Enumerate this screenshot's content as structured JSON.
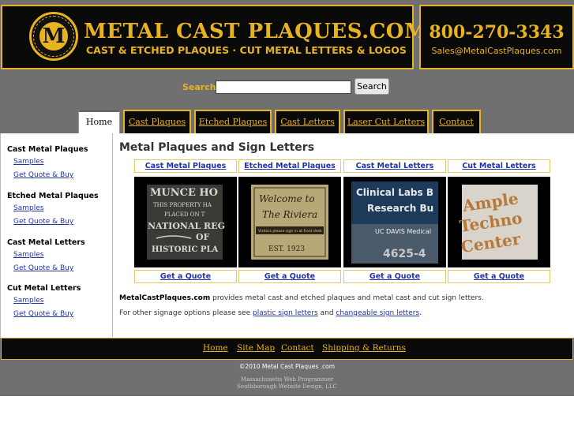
{
  "header": {
    "title": "METAL CAST PLAQUES.COM",
    "tagline": "CAST & ETCHED PLAQUES · CUT METAL LETTERS & LOGOS",
    "seal_letter": "M",
    "seal_ring_text": "CAST & ETCHED PLAQUES · METAL LETTERS & LOGOS",
    "phone": "800-270-3343",
    "email": "Sales@MetalCastPlaques.com"
  },
  "search": {
    "label": "Search:",
    "value": "",
    "placeholder": "",
    "button": "Search"
  },
  "tabs": [
    "Home",
    "Cast Plaques",
    "Etched Plaques",
    "Cast Letters",
    "Laser Cut Letters",
    "Contact"
  ],
  "active_tab": "Home",
  "sidebar": [
    {
      "heading": "Cast Metal Plaques",
      "links": [
        "Samples",
        "Get Quote & Buy"
      ]
    },
    {
      "heading": "Etched Metal Plaques",
      "links": [
        "Samples",
        "Get Quote & Buy"
      ]
    },
    {
      "heading": "Cast Metal Letters",
      "links": [
        "Samples",
        "Get Quote & Buy"
      ]
    },
    {
      "heading": "Cut Metal Letters",
      "links": [
        "Samples",
        "Get Quote & Buy"
      ]
    }
  ],
  "main": {
    "title": "Metal Plaques and Sign Letters",
    "products": [
      {
        "label": "Cast Metal Plaques",
        "quote": "Get a Quote",
        "photo_lines": [
          "MUNCE HO",
          "THIS PROPERTY HA",
          "PLACED ON T",
          "NATIONAL REG",
          "OF",
          "HISTORIC PLA"
        ]
      },
      {
        "label": "Etched Metal Plaques",
        "quote": "Get a Quote",
        "photo_lines": [
          "Welcome to",
          "The Riviera",
          "Visitors please sign in at front desk",
          "EST. 1923"
        ]
      },
      {
        "label": "Cast Metal Letters",
        "quote": "Get a Quote",
        "photo_lines": [
          "Clinical Labs B",
          "Research Bu",
          "UC DAVIS Medical",
          "4625-4"
        ]
      },
      {
        "label": "Cut Metal Letters",
        "quote": "Get a Quote",
        "photo_lines": [
          "Ample",
          "Techno",
          "Center"
        ]
      }
    ],
    "desc1_bold": "MetalCastPlaques.com",
    "desc1_rest": " provides metal cast and etched plaques and metal cast and cut sign letters.",
    "desc2_pre": "For other signage options please see ",
    "desc2_link1": "plastic sign letters",
    "desc2_mid": " and ",
    "desc2_link2": "changeable sign letters",
    "desc2_end": "."
  },
  "footer": {
    "links": [
      "Home",
      "Site Map",
      "Contact",
      "Shipping & Returns"
    ],
    "copyright": "©2010 Metal Cast Plaques .com",
    "credit1": "Massachusetts Web Programmer",
    "credit2": "Southborough Website Design, LLC"
  },
  "colors": {
    "gold": "#e8b320",
    "black": "#0a0a0a",
    "gray_band": "#707070",
    "link": "#2233aa"
  }
}
